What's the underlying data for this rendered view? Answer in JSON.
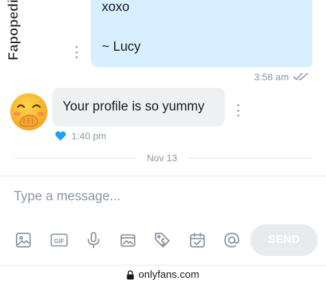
{
  "watermark": {
    "text": "Fapopedia"
  },
  "sent_message": {
    "line1": "xoxo",
    "line2": "~ Lucy",
    "time": "3:58 am",
    "status_icon": "double-check-icon"
  },
  "received_message": {
    "avatar_icon": "blushing-face-emoji",
    "text": "Your profile is so yummy",
    "time": "1:40 pm",
    "like_icon": "heart-icon",
    "like_color": "#1da1f2"
  },
  "date_separator": {
    "label": "Nov 13"
  },
  "composer": {
    "placeholder": "Type a message...",
    "value": "",
    "tools": [
      "image-icon",
      "gif-icon",
      "microphone-icon",
      "vault-icon",
      "price-tag-icon",
      "calendar-icon",
      "at-sign-icon"
    ],
    "gif_label": "GIF",
    "send_label": "SEND"
  },
  "url_bar": {
    "lock_icon": "lock-icon",
    "url": "onlyfans.com"
  },
  "colors": {
    "sent_bubble": "#d7efff",
    "received_bubble": "#eef0f2",
    "muted": "#8a96a3",
    "accent": "#1da1f2"
  }
}
